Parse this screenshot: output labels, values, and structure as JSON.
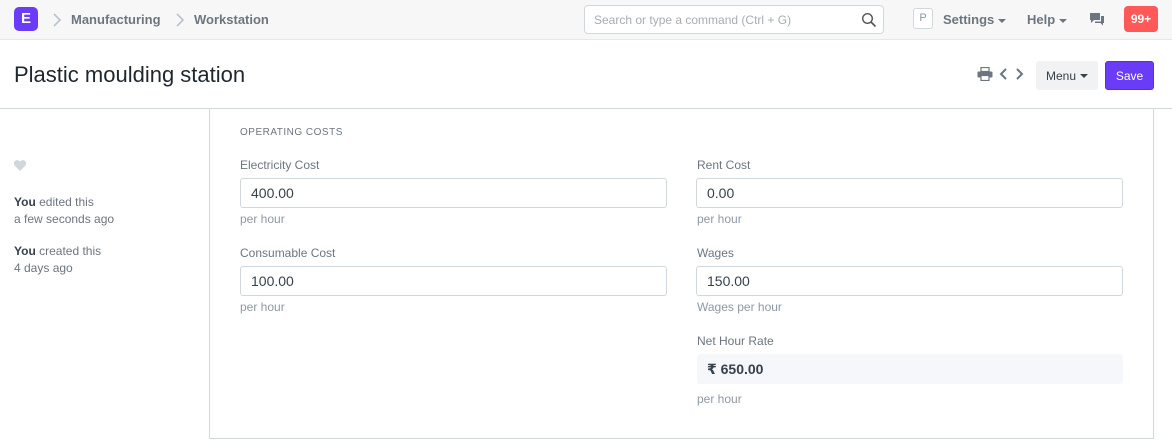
{
  "navbar": {
    "logo_letter": "E",
    "breadcrumbs": [
      "Manufacturing",
      "Workstation"
    ],
    "search_placeholder": "Search or type a command (Ctrl + G)",
    "avatar_letter": "P",
    "settings_label": "Settings",
    "help_label": "Help",
    "notification_count": "99+"
  },
  "page": {
    "title": "Plastic moulding station",
    "menu_label": "Menu",
    "save_label": "Save"
  },
  "sidebar": {
    "timeline": [
      {
        "actor": "You",
        "action": " edited this",
        "time": "a few seconds ago"
      },
      {
        "actor": "You",
        "action": " created this",
        "time": "4 days ago"
      }
    ]
  },
  "form": {
    "section_title": "Operating Costs",
    "electricity": {
      "label": "Electricity Cost",
      "value": "400.00",
      "description": "per hour"
    },
    "consumable": {
      "label": "Consumable Cost",
      "value": "100.00",
      "description": "per hour"
    },
    "rent": {
      "label": "Rent Cost",
      "value": "0.00",
      "description": "per hour"
    },
    "wages": {
      "label": "Wages",
      "value": "150.00",
      "description": "Wages per hour"
    },
    "net_hour_rate": {
      "label": "Net Hour Rate",
      "value": "₹ 650.00",
      "description": "per hour"
    }
  },
  "colors": {
    "brand": "#6b3cf7",
    "notification": "#ff5858"
  }
}
